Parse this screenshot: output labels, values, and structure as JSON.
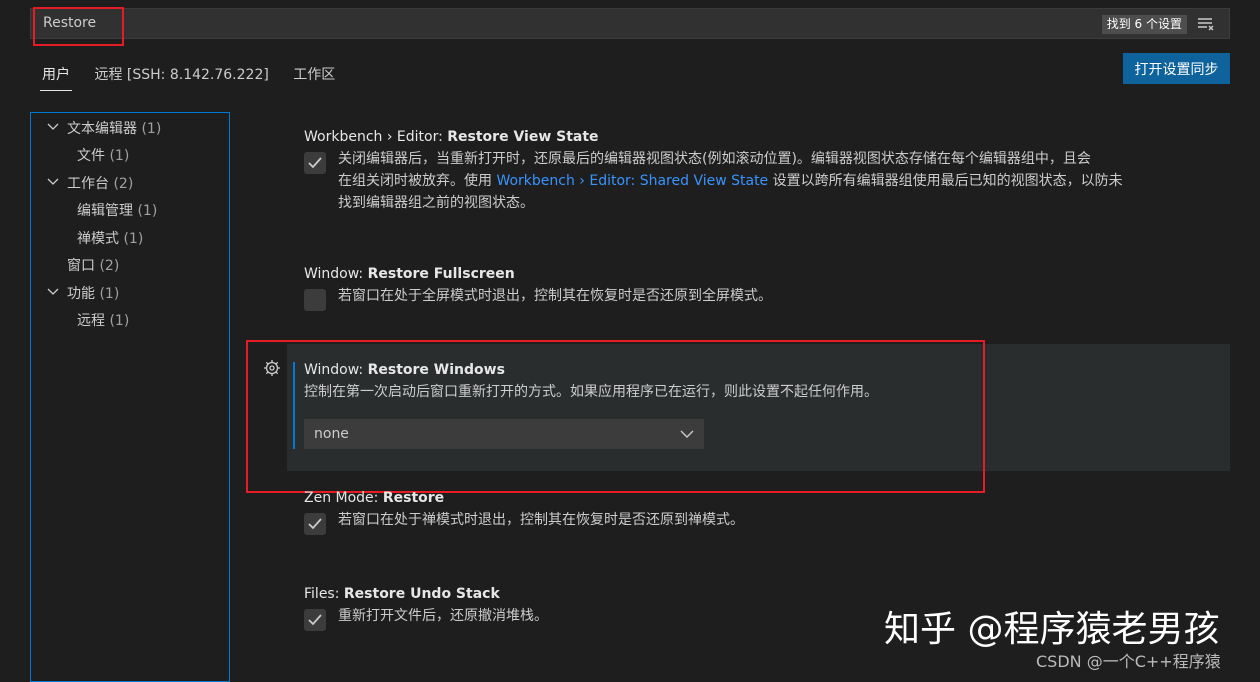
{
  "search": {
    "value": "Restore",
    "result_count": "找到 6 个设置"
  },
  "tabs": [
    {
      "label": "用户"
    },
    {
      "label": "远程 [SSH: 8.142.76.222]"
    },
    {
      "label": "工作区"
    }
  ],
  "sync_button": "打开设置同步",
  "toc": [
    {
      "label": "文本编辑器",
      "count": "(1)"
    },
    {
      "label": "文件",
      "count": "(1)"
    },
    {
      "label": "工作台",
      "count": "(2)"
    },
    {
      "label": "编辑管理",
      "count": "(1)"
    },
    {
      "label": "禅模式",
      "count": "(1)"
    },
    {
      "label": "窗口",
      "count": "(2)"
    },
    {
      "label": "功能",
      "count": "(1)"
    },
    {
      "label": "远程",
      "count": "(1)"
    }
  ],
  "settings": {
    "restore_view_state": {
      "category": "Workbench › Editor: ",
      "name": "Restore View State",
      "desc1": "关闭编辑器后，当重新打开时，还原最后的编辑器视图状态(例如滚动位置)。编辑器视图状态存储在每个编辑器组中，且会",
      "desc2a": "在组关闭时被放弃。使用 ",
      "desc2_link": "Workbench › Editor: Shared View State",
      "desc2b": " 设置以跨所有编辑器组使用最后已知的视图状态，以防未",
      "desc3": "找到编辑器组之前的视图状态。",
      "checked": true
    },
    "restore_fullscreen": {
      "category": "Window: ",
      "name": "Restore Fullscreen",
      "desc": "若窗口在处于全屏模式时退出，控制其在恢复时是否还原到全屏模式。",
      "checked": false
    },
    "restore_windows": {
      "category": "Window: ",
      "name": "Restore Windows",
      "desc": "控制在第一次启动后窗口重新打开的方式。如果应用程序已在运行，则此设置不起任何作用。",
      "value": "none"
    },
    "zen_restore": {
      "category": "Zen Mode: ",
      "name": "Restore",
      "desc": "若窗口在处于禅模式时退出，控制其在恢复时是否还原到禅模式。",
      "checked": true
    },
    "restore_undo_stack": {
      "category": "Files: ",
      "name": "Restore Undo Stack",
      "desc": "重新打开文件后，还原撤消堆栈。",
      "checked": true
    }
  },
  "watermark": {
    "main": "知乎 @程序猿老男孩",
    "sub": "CSDN @一个C++程序猿"
  },
  "colors": {
    "accent": "#0078d4",
    "button": "#0e639c",
    "highlight": "#e51c23",
    "link": "#3794ff"
  }
}
